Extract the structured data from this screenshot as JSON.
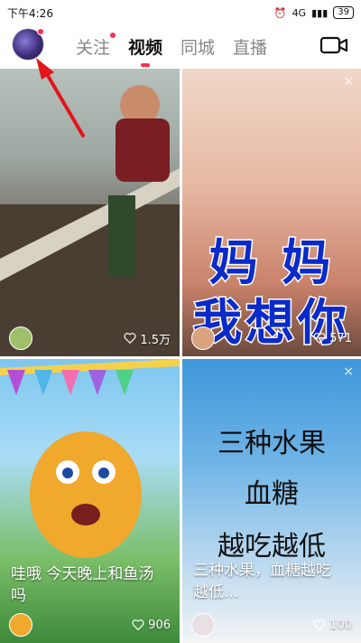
{
  "status_bar": {
    "time": "下午4:26",
    "network": "4G",
    "battery": "39"
  },
  "header": {
    "tabs": [
      {
        "label": "关注",
        "active": false,
        "has_dot": true
      },
      {
        "label": "视频",
        "active": true,
        "has_dot": false
      },
      {
        "label": "同城",
        "active": false,
        "has_dot": false
      },
      {
        "label": "直播",
        "active": false,
        "has_dot": false
      }
    ],
    "camera_icon": "video-camera-icon",
    "avatar_icon": "user-avatar"
  },
  "feed": [
    {
      "likes": "1.5万",
      "close": "×"
    },
    {
      "overlay_lines": [
        "妈 妈",
        "我想你"
      ],
      "likes": "571",
      "close": "×"
    },
    {
      "caption_lines": [
        "哇哦 今天晚上和鱼汤",
        "吗"
      ],
      "likes": "906"
    },
    {
      "title_lines": [
        "三种水果",
        "血糖",
        "越吃越低"
      ],
      "caption_lines": [
        "三种水果，血糖越吃",
        "越低..."
      ],
      "likes": "100",
      "close": "×"
    }
  ],
  "colors": {
    "accent": "#ff2b55",
    "overlay_blue": "#0a2ac9"
  }
}
